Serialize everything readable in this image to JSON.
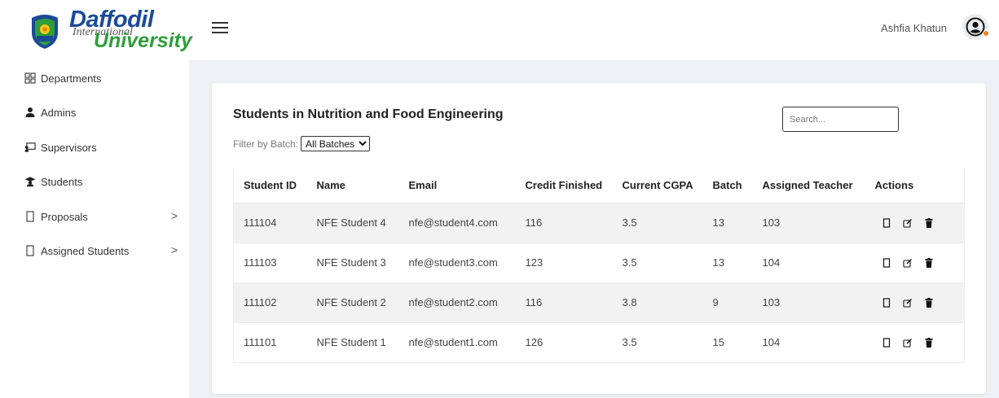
{
  "header": {
    "logo_top": "Daffodil",
    "logo_middle": "International",
    "logo_bottom": "University",
    "user_name": "Ashfia Khatun"
  },
  "sidebar": {
    "items": [
      {
        "label": "Departments",
        "icon": "grid-icon",
        "has_chevron": false
      },
      {
        "label": "Admins",
        "icon": "user-icon",
        "has_chevron": false
      },
      {
        "label": "Supervisors",
        "icon": "chalkboard-teacher-icon",
        "has_chevron": false
      },
      {
        "label": "Students",
        "icon": "graduation-cap-icon",
        "has_chevron": false
      },
      {
        "label": "Proposals",
        "icon": "document-icon",
        "has_chevron": true,
        "chevron": ">"
      },
      {
        "label": "Assigned Students",
        "icon": "document-icon",
        "has_chevron": true,
        "chevron": ">"
      }
    ]
  },
  "main": {
    "title": "Students in Nutrition and Food Engineering",
    "filter_label": "Filter by Batch:",
    "filter_selected": "All Batches",
    "search_placeholder": "Search...",
    "table": {
      "headers": [
        "Student ID",
        "Name",
        "Email",
        "Credit Finished",
        "Current CGPA",
        "Batch",
        "Assigned Teacher",
        "Actions"
      ],
      "rows": [
        [
          "111104",
          "NFE Student 4",
          "nfe@student4.com",
          "116",
          "3.5",
          "13",
          "103"
        ],
        [
          "111103",
          "NFE Student 3",
          "nfe@student3.com",
          "123",
          "3.5",
          "13",
          "104"
        ],
        [
          "111102",
          "NFE Student 2",
          "nfe@student2.com",
          "116",
          "3.8",
          "9",
          "103"
        ],
        [
          "111101",
          "NFE Student 1",
          "nfe@student1.com",
          "126",
          "3.5",
          "15",
          "104"
        ]
      ],
      "row_actions": [
        "view-icon",
        "edit-icon",
        "delete-icon"
      ]
    }
  },
  "colors": {
    "logo_blue": "#1b4a97",
    "logo_green": "#2e9e3a",
    "content_bg": "#eef0f4",
    "stripe": "#f2f2f2",
    "status_dot": "#fd7e14"
  }
}
